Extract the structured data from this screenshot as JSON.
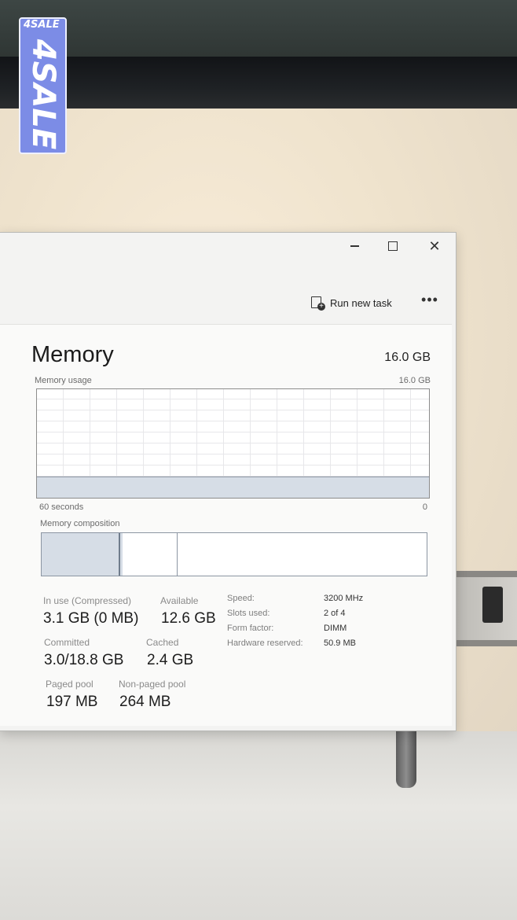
{
  "watermark": {
    "small": "4SALE",
    "big": "4SALE"
  },
  "window": {
    "controls": {
      "minimize": "–",
      "close": "✕"
    },
    "toolbar": {
      "run_new_task": "Run new task",
      "more": "•••"
    }
  },
  "memory": {
    "title": "Memory",
    "total": "16.0 GB",
    "usage_label": "Memory usage",
    "usage_max": "16.0 GB",
    "usage_fraction": 0.19,
    "graph_left": "60 seconds",
    "graph_right": "0",
    "composition_label": "Memory composition",
    "composition": {
      "in_use_fraction": 0.2,
      "standby_fraction": 0.14
    },
    "stats": {
      "in_use_label": "In use (Compressed)",
      "in_use_value": "3.1 GB (0 MB)",
      "available_label": "Available",
      "available_value": "12.6 GB",
      "committed_label": "Committed",
      "committed_value": "3.0/18.8 GB",
      "cached_label": "Cached",
      "cached_value": "2.4 GB",
      "paged_pool_label": "Paged pool",
      "paged_pool_value": "197 MB",
      "non_paged_pool_label": "Non-paged pool",
      "non_paged_pool_value": "264 MB"
    },
    "specs": {
      "speed_label": "Speed:",
      "speed_value": "3200 MHz",
      "slots_label": "Slots used:",
      "slots_value": "2 of 4",
      "form_label": "Form factor:",
      "form_value": "DIMM",
      "reserved_label": "Hardware reserved:",
      "reserved_value": "50.9 MB"
    }
  }
}
